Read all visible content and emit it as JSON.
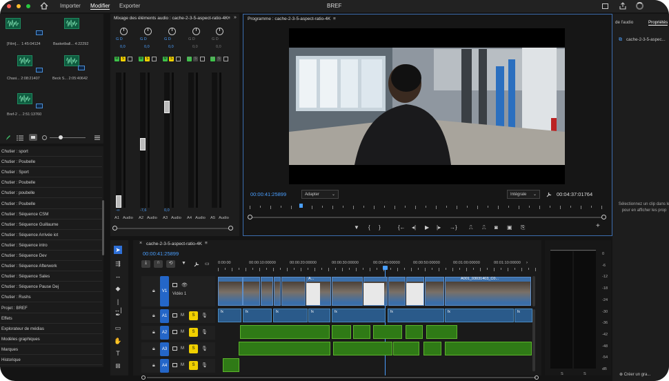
{
  "window": {
    "title": "BREF"
  },
  "menu": [
    "Importer",
    "Modifier",
    "Exporter"
  ],
  "bins": [
    {
      "name": "[Film]...",
      "duration": "1:45:04124"
    },
    {
      "name": "Basketball...",
      "duration": "4:22292"
    },
    {
      "name": "Chasi...",
      "duration": "2:08:21407"
    },
    {
      "name": "Beck S...",
      "duration": "2:05:40642"
    },
    {
      "name": "Bref-2 ...",
      "duration": "2:51:13760"
    }
  ],
  "project_list": [
    "Chutier : sport",
    "Chutier : Poubelle",
    "Chutier : Sport",
    "Chutier : Poubelle",
    "Chutier : poubelle",
    "Chutier : Poubelle",
    "Chutier : Séquence CSM",
    "Chutier : Séquence Guillaume",
    "Chutier : Séquence Arrivée iot",
    "Chutier : Séquence intro",
    "Chutier : Séquence Dev",
    "Chutier : Séquence Afterwork",
    "Chutier : Séquence Sales",
    "Chutier : Séquence Pause Dej",
    "Chutier : Rushs",
    "Projet : BREF",
    "Effets",
    "Explorateur de médias",
    "Modèles graphiques",
    "Marques",
    "Historique"
  ],
  "mixer": {
    "title": "Mixage des éléments audio : cache-2-3-5-aspect-ratio-4K",
    "pan_values": [
      "0,0",
      "0,0",
      "0,0",
      "0,0",
      "0,0"
    ],
    "gain_values": [
      "-∞",
      "-7,6",
      "0,0"
    ],
    "channels": [
      "A1",
      "Audio",
      "A2",
      "Audio",
      "A3",
      "Audio",
      "A4",
      "Audio",
      "A5",
      "Audio"
    ]
  },
  "program": {
    "title": "Programme : cache-2-3-5-aspect-ratio-4K",
    "timecode": "00:00:41:25899",
    "fit": "Adapter",
    "quality": "Intégrale",
    "duration": "00:04:37:01764"
  },
  "timeline": {
    "tab": "cache-2-3-5-aspect-ratio-4K",
    "timecode": "00:00:41:25899",
    "ruler": [
      "0:00:00",
      "00:00:10:00000",
      "00:00:20:00000",
      "00:00:30:00000",
      "00:00:40:00000",
      "00:00:50:00000",
      "00:01:00:00000",
      "00:01:10:00000"
    ],
    "tracks": [
      "V1",
      "A1",
      "A2",
      "A3",
      "A4"
    ],
    "video_track_name": "Vidéo 1",
    "clip_labels": [
      "A001_03031403_C0...",
      "A...",
      "fx"
    ]
  },
  "meter": {
    "labels": [
      "0",
      "-6",
      "-12",
      "-18",
      "-24",
      "-30",
      "-36",
      "-42",
      "-48",
      "-54",
      "dB"
    ],
    "channels": [
      "S",
      "S"
    ]
  },
  "right_panel": {
    "tabs": [
      "de l'audio",
      "Propriétés"
    ],
    "clip_name": "cache-2-3-5-aspec...",
    "hint": "Sélectionnez un clip dans le pour en afficher les prop",
    "create_button": "Créer un gra..."
  }
}
